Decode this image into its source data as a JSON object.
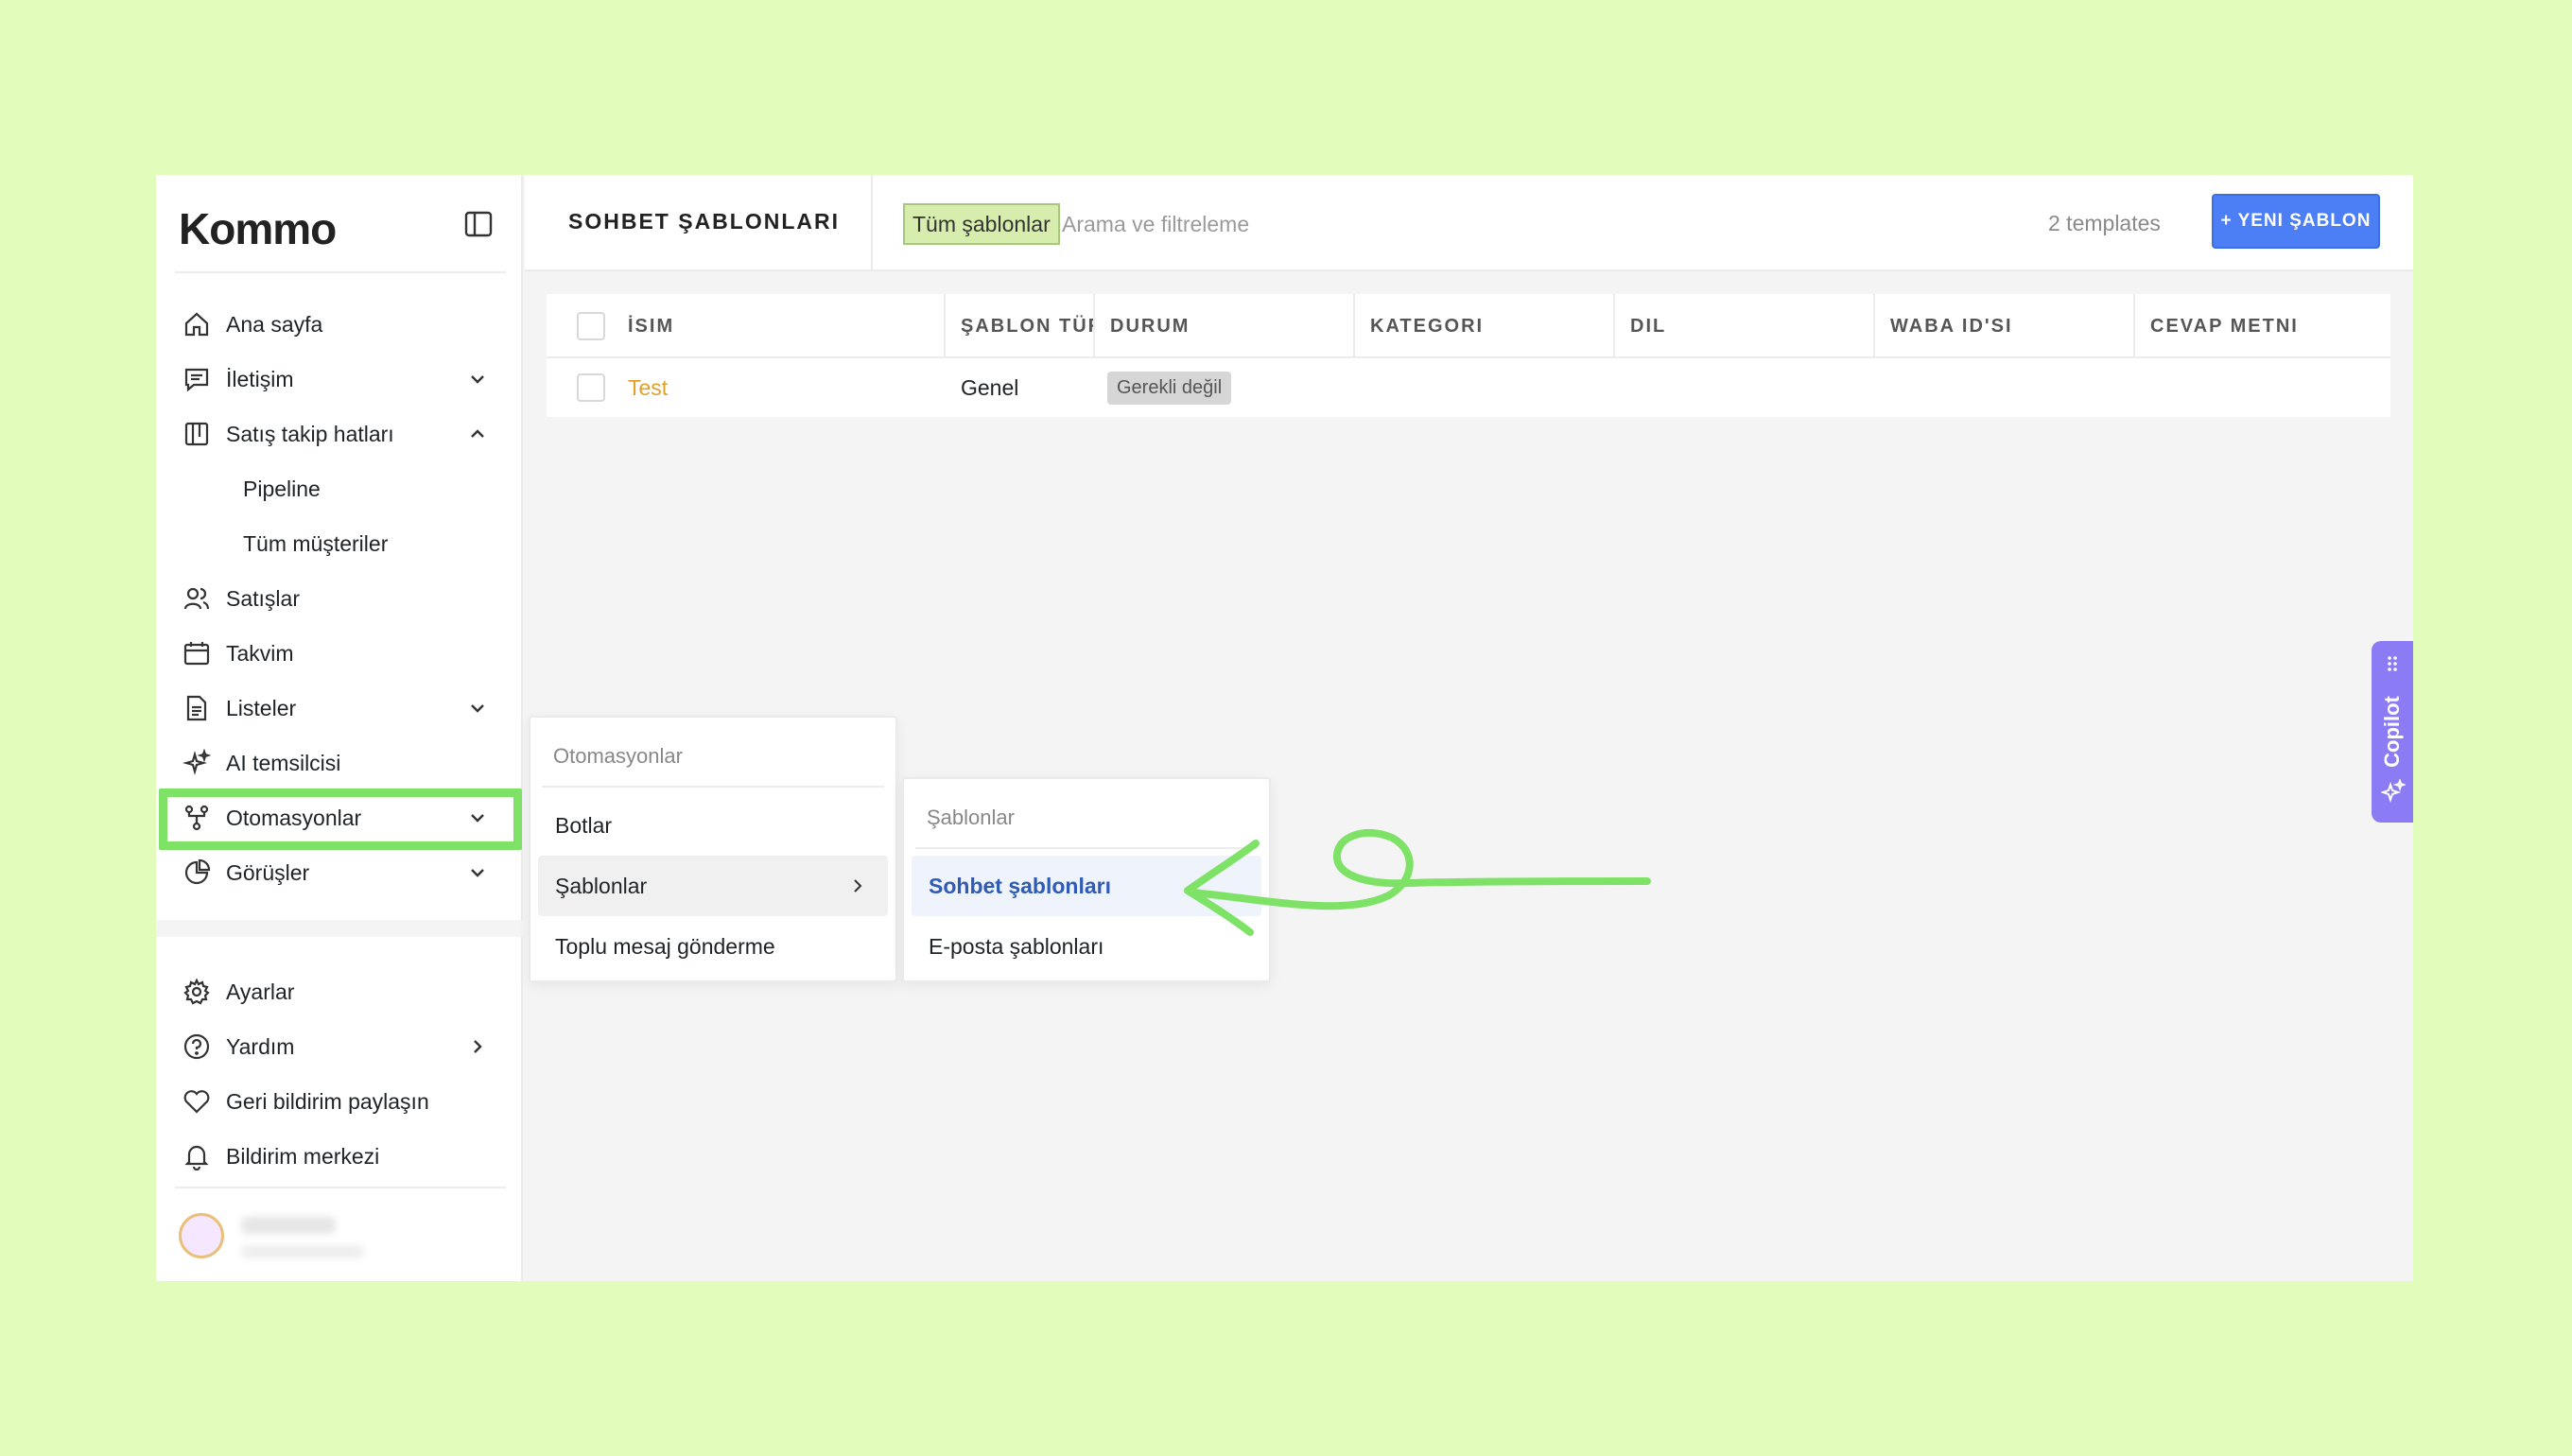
{
  "brand": {
    "logo": "Kommo"
  },
  "sidebar": {
    "items": [
      {
        "id": "home",
        "label": "Ana sayfa"
      },
      {
        "id": "contacts",
        "label": "İletişim"
      },
      {
        "id": "pipelines",
        "label": "Satış takip hatları"
      },
      {
        "id": "pipeline",
        "label": "Pipeline"
      },
      {
        "id": "all-customers",
        "label": "Tüm müşteriler"
      },
      {
        "id": "sales",
        "label": "Satışlar"
      },
      {
        "id": "calendar",
        "label": "Takvim"
      },
      {
        "id": "lists",
        "label": "Listeler"
      },
      {
        "id": "ai-agent",
        "label": "AI temsilcisi"
      },
      {
        "id": "automations",
        "label": "Otomasyonlar"
      },
      {
        "id": "insights",
        "label": "Görüşler"
      }
    ],
    "bottom_items": [
      {
        "id": "settings",
        "label": "Ayarlar"
      },
      {
        "id": "help",
        "label": "Yardım"
      },
      {
        "id": "feedback",
        "label": "Geri bildirim paylaşın"
      },
      {
        "id": "notifications",
        "label": "Bildirim merkezi"
      }
    ]
  },
  "header": {
    "title": "SOHBET ŞABLONLARI",
    "filter_chip": "Tüm şablonlar",
    "search_placeholder": "Arama ve filtreleme",
    "count": "2 templates",
    "new_button": "+ YENI ŞABLON"
  },
  "table": {
    "columns": [
      "İSIM",
      "ŞABLON TÜRÜ",
      "DURUM",
      "KATEGORI",
      "DIL",
      "WABA ID'SI",
      "CEVAP METNI"
    ],
    "rows": [
      {
        "name": "Test",
        "type": "Genel",
        "status": "Gerekli değil"
      }
    ]
  },
  "menu_automations": {
    "header": "Otomasyonlar",
    "items": [
      "Botlar",
      "Şablonlar",
      "Toplu mesaj gönderme"
    ]
  },
  "menu_templates": {
    "header": "Şablonlar",
    "items": [
      "Sohbet şablonları",
      "E-posta şablonları"
    ]
  },
  "copilot": {
    "label": "Copilot"
  },
  "colors": {
    "background": "#e2fcbb",
    "highlight": "#7ee267",
    "primary_button": "#4c7ef6",
    "template_link": "#e0a12a",
    "active_menu_text": "#2f5bb7",
    "copilot": "#8b7cf6"
  }
}
